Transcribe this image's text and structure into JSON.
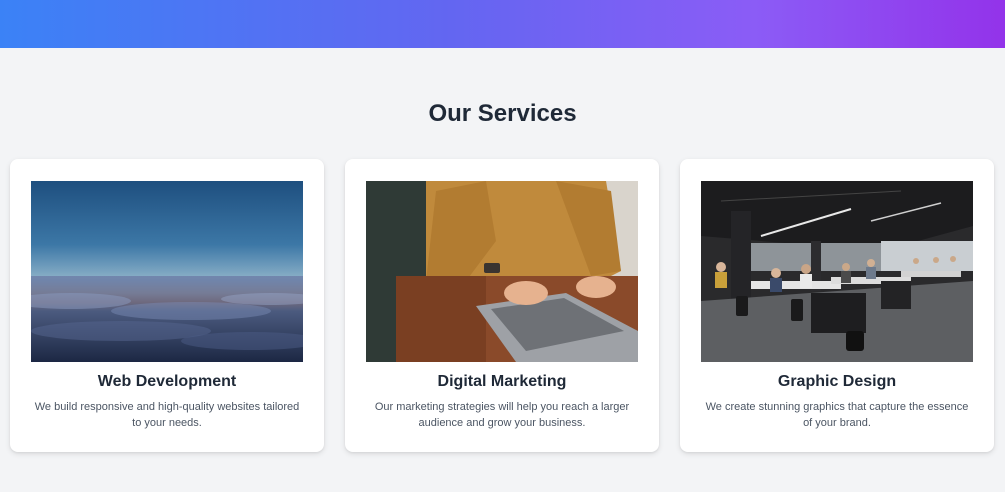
{
  "section": {
    "title": "Our Services"
  },
  "services": [
    {
      "title": "Web Development",
      "description": "We build responsive and high-quality websites tailored to your needs.",
      "image": "horizon-sunset-over-clouds"
    },
    {
      "title": "Digital Marketing",
      "description": "Our marketing strategies will help you reach a larger audience and grow your business.",
      "image": "person-typing-on-laptop"
    },
    {
      "title": "Graphic Design",
      "description": "We create stunning graphics that capture the essence of your brand.",
      "image": "open-plan-office-with-workers"
    }
  ],
  "colors": {
    "gradient_start": "#3b82f6",
    "gradient_end": "#9333ea",
    "background": "#f3f4f6",
    "heading": "#1f2937",
    "body_text": "#4b5563"
  }
}
